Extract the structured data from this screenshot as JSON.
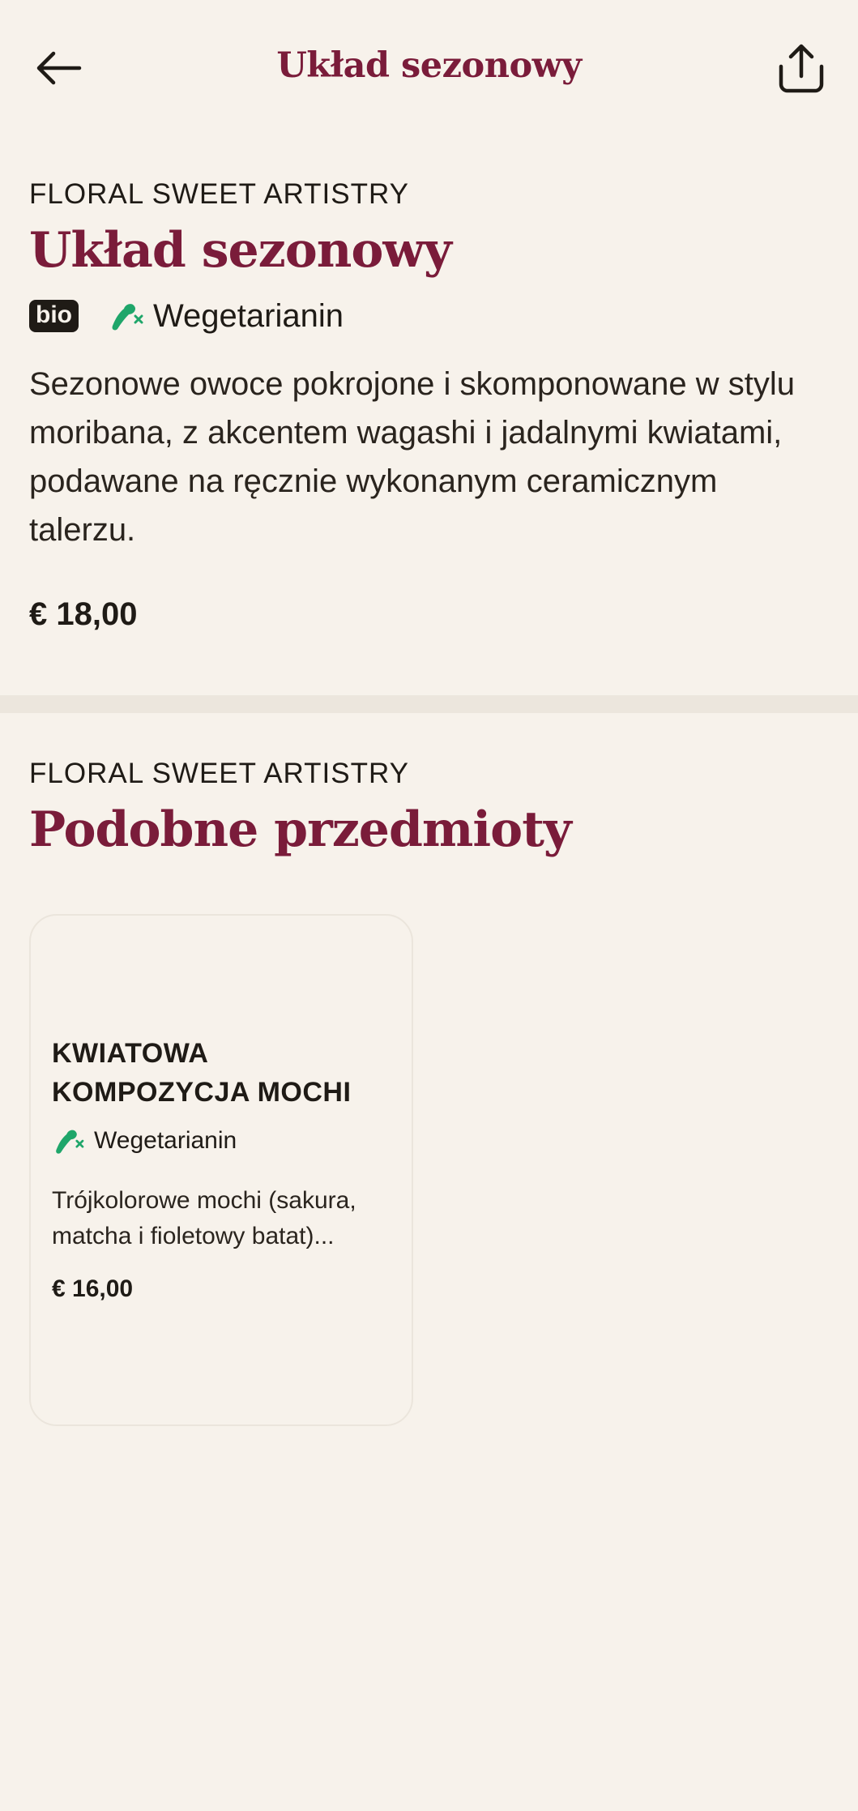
{
  "header": {
    "title": "Układ sezonowy",
    "back_icon": "arrow-left-icon",
    "share_icon": "share-icon"
  },
  "product": {
    "category": "FLORAL SWEET ARTISTRY",
    "name": "Układ sezonowy",
    "badge": "bio",
    "diet_label": "Wegetarianin",
    "diet_icon": "leg-crossed-icon",
    "description": "Sezonowe owoce pokrojone i skomponowane w stylu moribana, z akcentem wagashi i jadalnymi kwiatami, podawane na ręcznie wykonanym ceramicznym talerzu.",
    "price": "€ 18,00"
  },
  "similar": {
    "category": "FLORAL SWEET ARTISTRY",
    "title": "Podobne przedmioty",
    "items": [
      {
        "name": "KWIATOWA KOMPOZYCJA MOCHI",
        "diet_label": "Wegetarianin",
        "description": "Trójkolorowe mochi (sakura, matcha i fioletowy batat)...",
        "price": "€ 16,00"
      }
    ]
  },
  "colors": {
    "background": "#f7f2eb",
    "accent": "#7a1c3a",
    "text": "#1f1b16",
    "veg_green": "#1fa66a"
  }
}
